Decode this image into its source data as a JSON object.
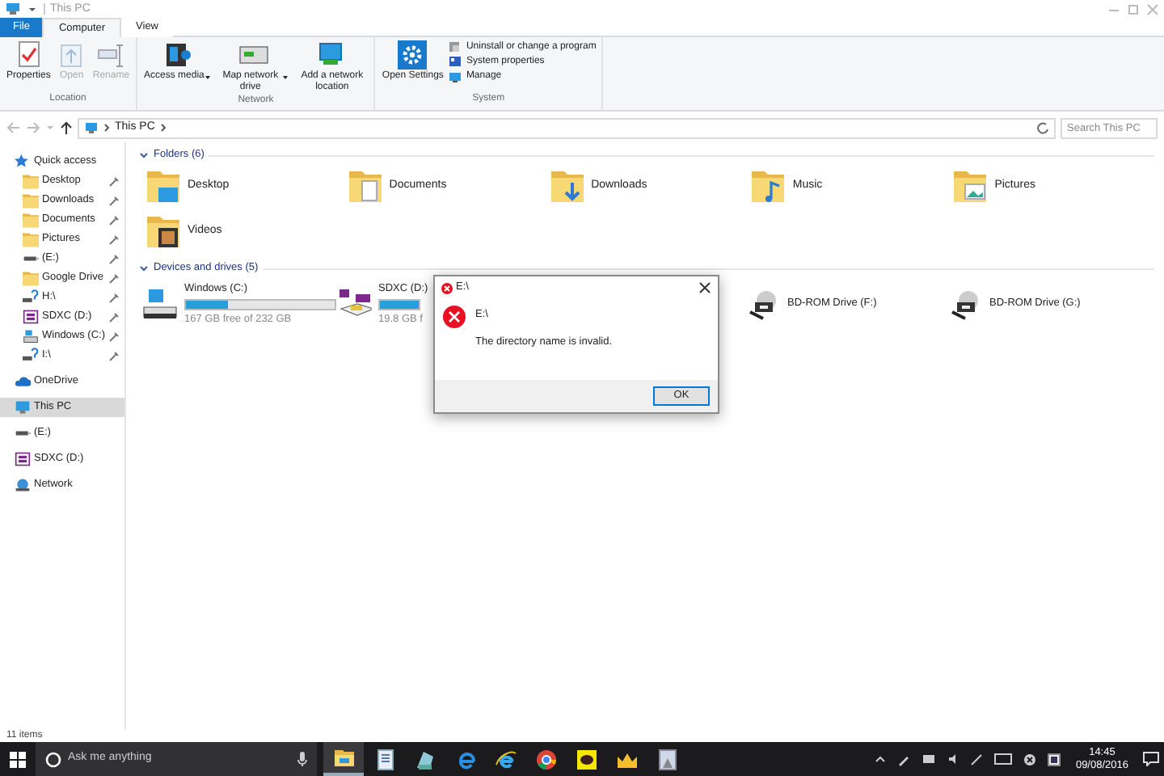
{
  "window": {
    "title": "This PC"
  },
  "tabs": [
    {
      "label": "File",
      "kind": "file",
      "selected": false
    },
    {
      "label": "Computer",
      "kind": "tab",
      "selected": true
    },
    {
      "label": "View",
      "kind": "tab",
      "selected": false
    }
  ],
  "ribbon": {
    "groups": [
      {
        "label": "Location",
        "buttons": [
          {
            "label": "Properties",
            "kind": "properties",
            "disabled": false,
            "dropdown": false
          },
          {
            "label": "Open",
            "kind": "open",
            "disabled": true,
            "dropdown": false
          },
          {
            "label": "Rename",
            "kind": "rename",
            "disabled": true,
            "dropdown": false
          }
        ]
      },
      {
        "label": "Network",
        "buttons": [
          {
            "label": "Access media",
            "kind": "media",
            "disabled": false,
            "dropdown": true
          },
          {
            "label": "Map network drive",
            "kind": "mapdrive",
            "disabled": false,
            "dropdown": true
          },
          {
            "label": "Add a network location",
            "kind": "netloc",
            "disabled": false,
            "dropdown": false
          }
        ]
      },
      {
        "label": "System",
        "buttons": [
          {
            "label": "Open Settings",
            "kind": "settings",
            "disabled": false,
            "dropdown": false
          }
        ],
        "small_buttons": [
          {
            "label": "Uninstall or change a program",
            "kind": "uninstall"
          },
          {
            "label": "System properties",
            "kind": "sysprops"
          },
          {
            "label": "Manage",
            "kind": "manage"
          }
        ]
      }
    ]
  },
  "address": {
    "path": "This PC",
    "search_placeholder": "Search This PC"
  },
  "sidebar": {
    "items": [
      {
        "label": "Quick access",
        "kind": "star",
        "selected": false,
        "children": [
          {
            "label": "Desktop",
            "kind": "folder",
            "pinned": true,
            "selected": false
          },
          {
            "label": "Downloads",
            "kind": "folder",
            "pinned": true,
            "selected": false
          },
          {
            "label": "Documents",
            "kind": "folder",
            "pinned": true,
            "selected": false
          },
          {
            "label": "Pictures",
            "kind": "folder",
            "pinned": true,
            "selected": false
          },
          {
            "label": "(E:)",
            "kind": "usb",
            "pinned": true,
            "selected": false
          },
          {
            "label": "Google Drive",
            "kind": "folder",
            "pinned": true,
            "selected": false
          },
          {
            "label": "H:\\",
            "kind": "unknown",
            "pinned": true,
            "selected": false
          },
          {
            "label": "SDXC (D:)",
            "kind": "sd",
            "pinned": true,
            "selected": false
          },
          {
            "label": "Windows (C:)",
            "kind": "drive",
            "pinned": true,
            "selected": false
          },
          {
            "label": "I:\\",
            "kind": "unknown",
            "pinned": true,
            "selected": false
          }
        ]
      },
      {
        "label": "OneDrive",
        "kind": "cloud",
        "selected": false
      },
      {
        "label": "This PC",
        "kind": "pc",
        "selected": true
      },
      {
        "label": "(E:)",
        "kind": "usb",
        "selected": false
      },
      {
        "label": "SDXC (D:)",
        "kind": "sd",
        "selected": false
      },
      {
        "label": "Network",
        "kind": "network",
        "selected": false
      }
    ]
  },
  "folders": {
    "heading": "Folders (6)",
    "items": [
      {
        "label": "Desktop",
        "kind": "desktop"
      },
      {
        "label": "Documents",
        "kind": "document"
      },
      {
        "label": "Downloads",
        "kind": "download"
      },
      {
        "label": "Music",
        "kind": "music"
      },
      {
        "label": "Pictures",
        "kind": "picture"
      },
      {
        "label": "Videos",
        "kind": "video"
      }
    ]
  },
  "drives": {
    "heading": "Devices and drives (5)",
    "items": [
      {
        "label": "Windows (C:)",
        "kind": "disk",
        "level": 0.28,
        "free": "167 GB free of 232 GB"
      },
      {
        "label": "SDXC (D:)",
        "kind": "sd",
        "level": 1,
        "free": "19.8 GB f"
      },
      {
        "label": "BD-ROM Drive (F:)",
        "kind": "optical"
      },
      {
        "label": "BD-ROM Drive (G:)",
        "kind": "optical"
      }
    ]
  },
  "dialog": {
    "title": "E:\\",
    "heading": "E:\\",
    "message": "The directory name is invalid.",
    "button": "OK"
  },
  "status_bar": {
    "text": "11 items"
  },
  "taskbar": {
    "search_placeholder": "Ask me anything",
    "apps": [
      {
        "kind": "explorer",
        "selected": true
      },
      {
        "kind": "notepad",
        "selected": false
      },
      {
        "kind": "paint",
        "selected": false
      },
      {
        "kind": "edge",
        "selected": false
      },
      {
        "kind": "ie",
        "selected": false
      },
      {
        "kind": "chrome",
        "selected": false
      },
      {
        "kind": "chat",
        "selected": false
      },
      {
        "kind": "game",
        "selected": false
      },
      {
        "kind": "photo",
        "selected": false
      }
    ],
    "time": "14:45",
    "date": "09/08/2016"
  }
}
